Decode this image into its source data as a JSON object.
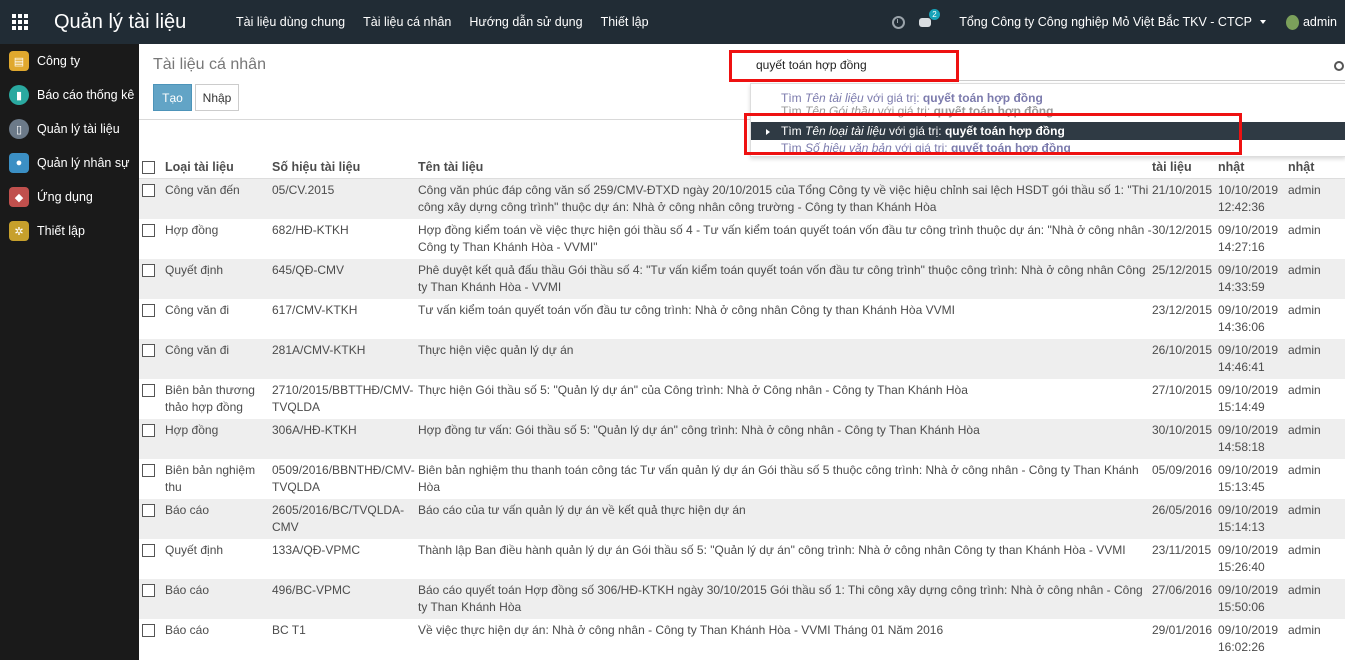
{
  "topbar": {
    "brand": "Quản lý tài liệu",
    "menu": [
      "Tài liệu dùng chung",
      "Tài liệu cá nhân",
      "Hướng dẫn sử dụng",
      "Thiết lập"
    ],
    "chat_count": "2",
    "company": "Tổng Công ty Công nghiệp Mỏ Việt Bắc TKV - CTCP",
    "user": "admin"
  },
  "sidebar": {
    "items": [
      {
        "label": "Công ty",
        "icon": "company-icon",
        "color": "#e0a82e"
      },
      {
        "label": "Báo cáo thống kê",
        "icon": "chart-icon",
        "color": "#2aa9a0"
      },
      {
        "label": "Quản lý tài liệu",
        "icon": "document-icon",
        "color": "#6c7a89"
      },
      {
        "label": "Quản lý nhân sự",
        "icon": "people-icon",
        "color": "#3b8fc4"
      },
      {
        "label": "Ứng dụng",
        "icon": "apps-icon",
        "color": "#c0504d"
      },
      {
        "label": "Thiết lập",
        "icon": "settings-icon",
        "color": "#c7a02c"
      }
    ]
  },
  "control_panel": {
    "breadcrumb": "Tài liệu cá nhân",
    "create_label": "Tạo",
    "import_label": "Nhập"
  },
  "search": {
    "value": "quyết toán hợp đồng",
    "suggestions": [
      {
        "prefix": "Tìm ",
        "field": "Tên tài liệu",
        "mid": " với giá trị: ",
        "query": "quyết toán hợp đồng"
      },
      {
        "prefix": "Tìm ",
        "field": "Tên Gói thầu",
        "mid": " với giá trị: ",
        "query": "quyết toán hợp đồng"
      },
      {
        "prefix": "Tìm ",
        "field": "Tên loại tài liệu",
        "mid": " với giá trị: ",
        "query": "quyết toán hợp đồng"
      },
      {
        "prefix": "Tìm ",
        "field": "Số hiệu văn bản",
        "mid": " với giá trị: ",
        "query": "quyết toán hợp đồng"
      }
    ]
  },
  "table": {
    "headers": [
      "Loại tài liệu",
      "Số hiệu tài liệu",
      "Tên tài liệu",
      "tài liệu",
      "nhật",
      "nhật"
    ],
    "rows": [
      [
        "Công văn đến",
        "05/CV.2015",
        "Công văn phúc đáp công văn số 259/CMV-ĐTXD ngày 20/10/2015 của Tổng Công ty về việc hiệu chỉnh sai lệch HSDT gói thầu số 1: \"Thi công xây dựng công trình\" thuộc dự án: Nhà ở công nhân công trường - Công ty than Khánh Hòa",
        "21/10/2015",
        "10/10/2019 12:42:36",
        "admin"
      ],
      [
        "Hợp đồng",
        "682/HĐ-KTKH",
        "Hợp đồng kiểm toán về việc thực hiện gói thầu số 4 - Tư vấn kiểm toán quyết toán vốn đầu tư công trình thuộc dự án: \"Nhà ở công nhân - Công ty Than Khánh Hòa - VVMI\"",
        "30/12/2015",
        "09/10/2019 14:27:16",
        "admin"
      ],
      [
        "Quyết định",
        "645/QĐ-CMV",
        "Phê duyệt kết quả đấu thầu Gói thầu số 4: \"Tư vấn kiểm toán quyết toán vốn đầu tư công trình\" thuộc công trình: Nhà ở công nhân Công ty Than Khánh Hòa - VVMI",
        "25/12/2015",
        "09/10/2019 14:33:59",
        "admin"
      ],
      [
        "Công văn đi",
        "617/CMV-KTKH",
        "Tư vấn kiểm toán quyết toán vốn đầu tư công trình: Nhà ở công nhân Công ty than Khánh Hòa VVMI",
        "23/12/2015",
        "09/10/2019 14:36:06",
        "admin"
      ],
      [
        "Công văn đi",
        "281A/CMV-KTKH",
        "Thực hiện việc quản lý dự án",
        "26/10/2015",
        "09/10/2019 14:46:41",
        "admin"
      ],
      [
        "Biên bản thương thảo hợp đồng",
        "2710/2015/BBTTHĐ/CMV-TVQLDA",
        "Thực hiện Gói thầu số 5: \"Quản lý dự án\" của Công trình: Nhà ở Công nhân - Công ty Than Khánh Hòa",
        "27/10/2015",
        "09/10/2019 15:14:49",
        "admin"
      ],
      [
        "Hợp đồng",
        "306A/HĐ-KTKH",
        "Hợp đồng tư vấn: Gói thầu số 5: \"Quản lý dự án\" công trình: Nhà ở công nhân - Công ty Than Khánh Hòa",
        "30/10/2015",
        "09/10/2019 14:58:18",
        "admin"
      ],
      [
        "Biên bản nghiệm thu",
        "0509/2016/BBNTHĐ/CMV-TVQLDA",
        "Biên bản nghiệm thu thanh toán công tác Tư vấn quản lý dự án Gói thầu số 5 thuộc công trình: Nhà ở công nhân - Công ty Than Khánh Hòa",
        "05/09/2016",
        "09/10/2019 15:13:45",
        "admin"
      ],
      [
        "Báo cáo",
        "2605/2016/BC/TVQLDA-CMV",
        "Báo cáo của tư vấn quản lý dự án về kết quả thực hiện dự án",
        "26/05/2016",
        "09/10/2019 15:14:13",
        "admin"
      ],
      [
        "Quyết định",
        "133A/QĐ-VPMC",
        "Thành lập Ban điều hành quản lý dự án Gói thầu số 5: \"Quản lý dự án\" công trình: Nhà ở công nhân Công ty than Khánh Hòa - VVMI",
        "23/11/2015",
        "09/10/2019 15:26:40",
        "admin"
      ],
      [
        "Báo cáo",
        "496/BC-VPMC",
        "Báo cáo quyết toán Hợp đồng số 306/HĐ-KTKH ngày 30/10/2015 Gói thầu số 1: Thi công xây dựng công trình: Nhà ở công nhân - Công ty Than Khánh Hòa",
        "27/06/2016",
        "09/10/2019 15:50:06",
        "admin"
      ],
      [
        "Báo cáo",
        "BC T1",
        "Về việc thực hiện dự án: Nhà ở công nhân - Công ty Than Khánh Hòa - VVMI Tháng 01 Năm 2016",
        "29/01/2016",
        "09/10/2019 16:02:26",
        "admin"
      ]
    ]
  }
}
